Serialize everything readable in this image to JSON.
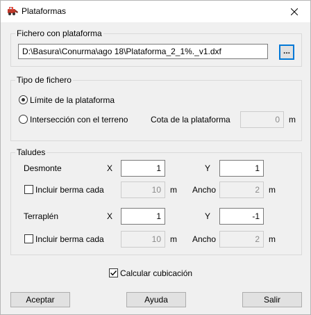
{
  "window": {
    "title": "Plataformas",
    "icon": "excavator-icon",
    "close_icon": "close-icon"
  },
  "fichero": {
    "group_label": "Fichero con plataforma",
    "path": "D:\\Basura\\Conurma\\ago 18\\Plataforma_2_1%._v1.dxf",
    "browse_label": "..."
  },
  "tipo": {
    "group_label": "Tipo de fichero",
    "option_limite": "Límite de la plataforma",
    "option_interseccion": "Intersección con el terreno",
    "selected": "limite",
    "cota_label": "Cota de la plataforma",
    "cota_value": "0",
    "cota_unit": "m"
  },
  "taludes": {
    "group_label": "Taludes",
    "desmonte": {
      "label": "Desmonte",
      "x_label": "X",
      "x_value": "1",
      "y_label": "Y",
      "y_value": "1",
      "berma_label": "Incluir berma cada",
      "berma_checked": false,
      "berma_value": "10",
      "berma_unit": "m",
      "ancho_label": "Ancho",
      "ancho_value": "2",
      "ancho_unit": "m"
    },
    "terraplen": {
      "label": "Terraplén",
      "x_label": "X",
      "x_value": "1",
      "y_label": "Y",
      "y_value": "-1",
      "berma_label": "Incluir berma cada",
      "berma_checked": false,
      "berma_value": "10",
      "berma_unit": "m",
      "ancho_label": "Ancho",
      "ancho_value": "2",
      "ancho_unit": "m"
    }
  },
  "calcular": {
    "label": "Calcular cubicación",
    "checked": true
  },
  "buttons": {
    "aceptar": "Aceptar",
    "ayuda": "Ayuda",
    "salir": "Salir"
  },
  "colors": {
    "focus_accent": "#0078d7",
    "dialog_bg": "#f0f0f0"
  }
}
